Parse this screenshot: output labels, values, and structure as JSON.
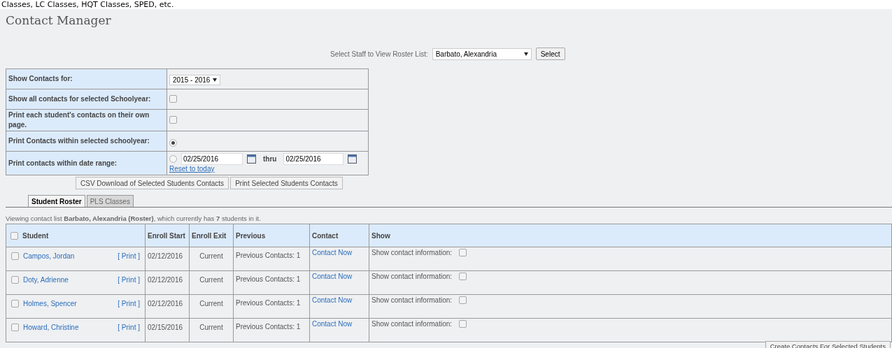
{
  "top_text": "Classes, LC Classes, HQT Classes, SPED, etc.",
  "title": "Contact Manager",
  "staff": {
    "label": "Select Staff to View Roster List:",
    "value": "Barbato, Alexandria",
    "button": "Select"
  },
  "options": [
    {
      "kind": "select",
      "label": "Show Contacts for:",
      "value": "2015 - 2016"
    },
    {
      "kind": "checkbox",
      "label": "Show all contacts for selected Schoolyear:",
      "checked": false
    },
    {
      "kind": "checkbox",
      "label": "Print each student's contacts on their own page.",
      "checked": false
    },
    {
      "kind": "radio",
      "label": "Print Contacts within selected schoolyear:",
      "selected": true
    },
    {
      "kind": "daterange",
      "label": "Print contacts within date range:",
      "selected": false,
      "from": "02/25/2016",
      "thru": "thru",
      "to": "02/25/2016",
      "link": "Reset to today"
    }
  ],
  "action_buttons": [
    "CSV Download of Selected Students Contacts",
    "Print Selected Students Contacts"
  ],
  "tabs": [
    {
      "label": "Student Roster",
      "selected": true
    },
    {
      "label": "PLS Classes",
      "selected": false
    }
  ],
  "summary": "Viewing contact list **Barbato, Alexandria (Roster)**, which currently has **7** students in it.",
  "table": {
    "select_all": false,
    "columns": [
      "Student",
      "Enroll Start",
      "Enroll Exit",
      "Previous",
      "Contact",
      "Show"
    ],
    "rows": [
      {
        "checked": false,
        "student": "Campos, Jordan",
        "print": "[ Print ]",
        "start": "02/12/2016",
        "exit": "Current",
        "previous": "Previous Contacts: 1",
        "contact": "Contact Now",
        "show": "Show contact information:",
        "show_checked": false
      },
      {
        "checked": false,
        "student": "Doty, Adrienne",
        "print": "[ Print ]",
        "start": "02/12/2016",
        "exit": "Current",
        "previous": "Previous Contacts: 1",
        "contact": "Contact Now",
        "show": "Show contact information:",
        "show_checked": false
      },
      {
        "checked": false,
        "student": "Holmes, Spencer",
        "print": "[ Print ]",
        "start": "02/12/2016",
        "exit": "Current",
        "previous": "Previous Contacts: 1",
        "contact": "Contact Now",
        "show": "Show contact information:",
        "show_checked": false
      },
      {
        "checked": false,
        "student": "Howard, Christine",
        "print": "[ Print ]",
        "start": "02/15/2016",
        "exit": "Current",
        "previous": "Previous Contacts: 1",
        "contact": "Contact Now",
        "show": "Show contact information:",
        "show_checked": false
      }
    ]
  },
  "create_button": "Create Contacts For Selected Students"
}
